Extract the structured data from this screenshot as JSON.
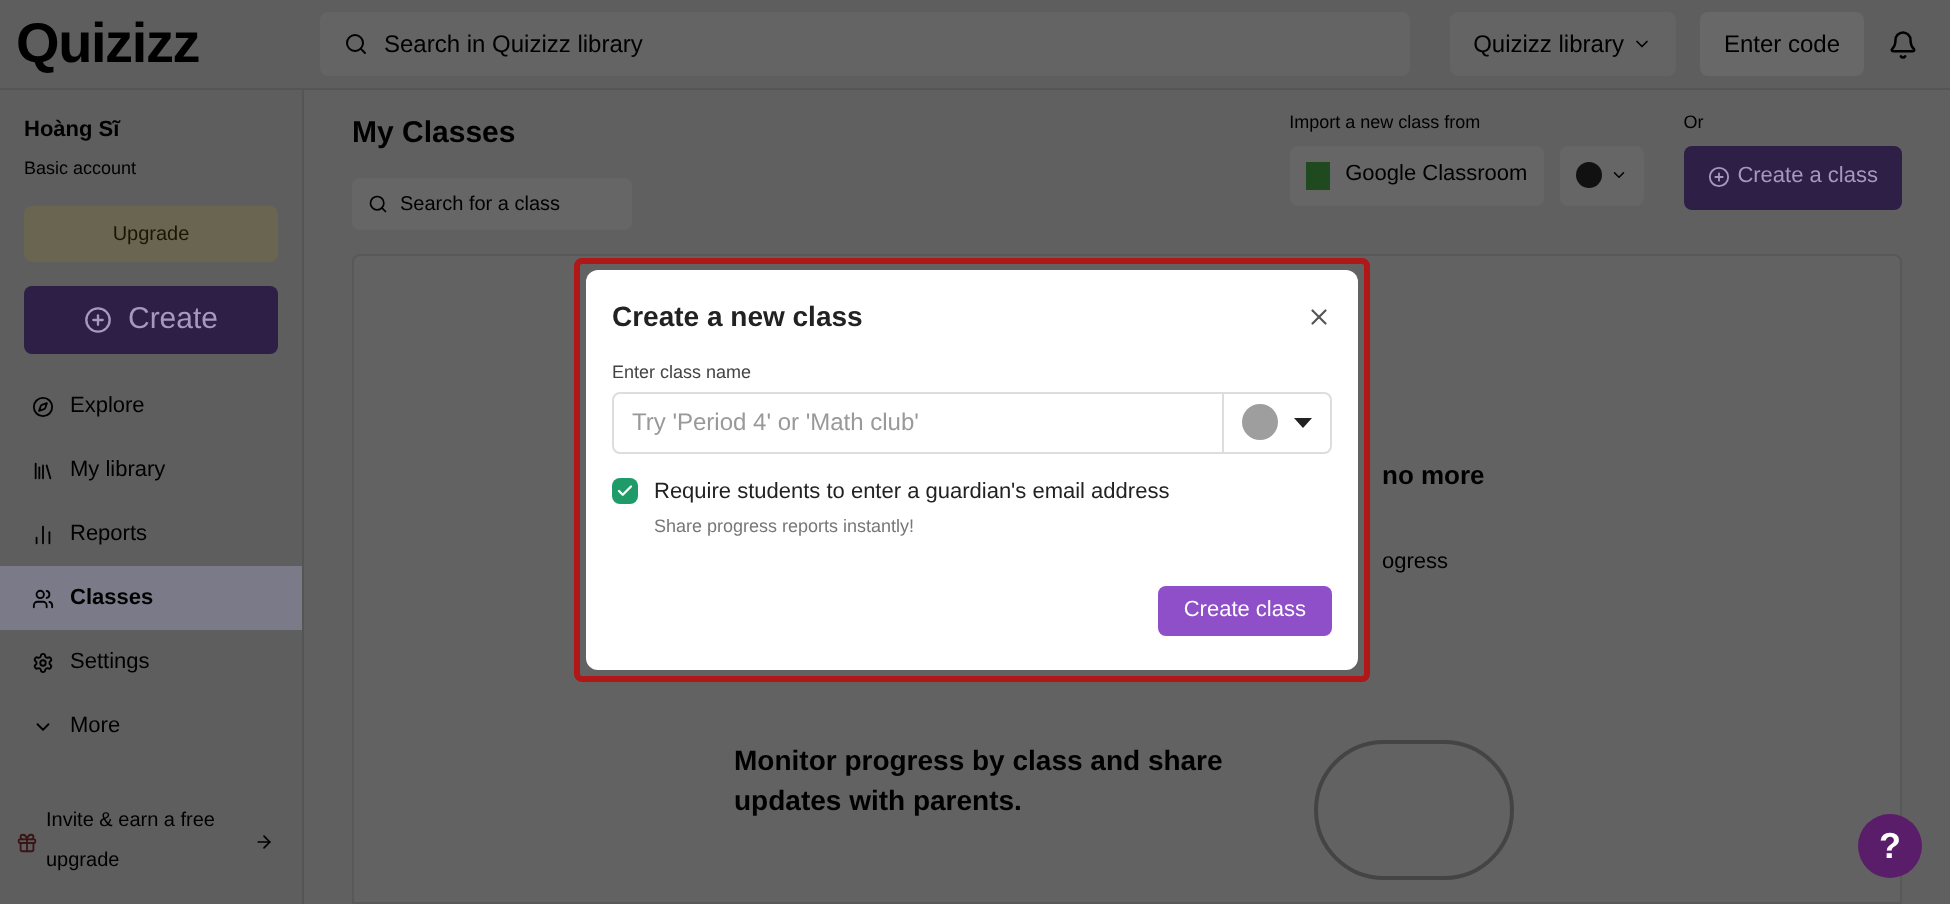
{
  "topbar": {
    "logo": "Quizizz",
    "search": {
      "placeholder": "Search in Quizizz library"
    },
    "library_select": "Quizizz library",
    "enter_code": "Enter code"
  },
  "sidebar": {
    "user_name": "Hoàng Sĩ",
    "account": "Basic account",
    "upgrade": "Upgrade",
    "create": "Create",
    "items": [
      {
        "label": "Explore",
        "selected": false
      },
      {
        "label": "My library",
        "selected": false
      },
      {
        "label": "Reports",
        "selected": false
      },
      {
        "label": "Classes",
        "selected": true
      },
      {
        "label": "Settings",
        "selected": false
      },
      {
        "label": "More",
        "selected": false
      }
    ],
    "invite": "Invite & earn a free upgrade"
  },
  "main": {
    "title": "My Classes",
    "search": {
      "placeholder": "Search for a class"
    },
    "import_label": "Import a new class from",
    "google_classroom": "Google Classroom",
    "or_label": "Or",
    "create_class": "Create a class",
    "card_fragments": [
      "no more",
      "ogress"
    ],
    "card_text": "Monitor progress by class and share updates with parents."
  },
  "dialog": {
    "title": "Create a new class",
    "field_label": "Enter class name",
    "field": {
      "placeholder": "Try 'Period 4' or 'Math club'"
    },
    "color": "#9e9e9e",
    "checkbox": {
      "label": "Require students to enter a guardian's email address",
      "hint": "Share progress reports instantly!",
      "checked": true
    },
    "submit": "Create class"
  },
  "help": "?"
}
